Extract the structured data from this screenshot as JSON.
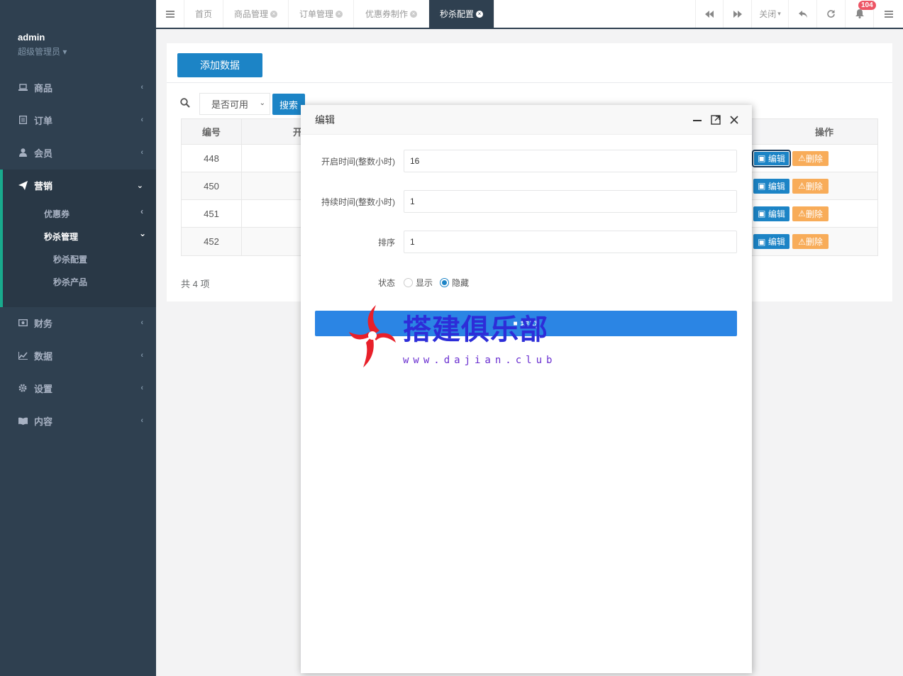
{
  "sidebar": {
    "user": "admin",
    "role": "超级管理员",
    "menu": [
      {
        "label": "商品",
        "icon": "laptop-icon"
      },
      {
        "label": "订单",
        "icon": "list-icon"
      },
      {
        "label": "会员",
        "icon": "user-icon"
      },
      {
        "label": "营销",
        "icon": "send-icon"
      },
      {
        "label": "财务",
        "icon": "money-icon"
      },
      {
        "label": "数据",
        "icon": "chart-icon"
      },
      {
        "label": "设置",
        "icon": "gear-icon"
      },
      {
        "label": "内容",
        "icon": "book-icon"
      }
    ],
    "submenu": {
      "coupon": "优惠券",
      "seckill": "秒杀管理",
      "seckill_config": "秒杀配置",
      "seckill_product": "秒杀产品"
    }
  },
  "topbar": {
    "tabs": [
      "首页",
      "商品管理",
      "订单管理",
      "优惠券制作",
      "秒杀配置"
    ],
    "active_tab": "秒杀配置",
    "close_label": "关闭",
    "notification_count": "104"
  },
  "toolbar": {
    "add_label": "添加数据",
    "filter_value": "是否可用",
    "search_label": "搜索"
  },
  "table": {
    "headers": {
      "id": "编号",
      "open": "开",
      "ops": "操作"
    },
    "rows": [
      {
        "id": "448"
      },
      {
        "id": "450"
      },
      {
        "id": "451"
      },
      {
        "id": "452"
      }
    ],
    "edit_label": "编辑",
    "delete_label": "删除",
    "total": "共 4 项"
  },
  "modal": {
    "title": "编辑",
    "fields": [
      {
        "label": "开启时间(整数小时)",
        "value": "16"
      },
      {
        "label": "持续时间(整数小时)",
        "value": "1"
      },
      {
        "label": "排序",
        "value": "1"
      }
    ],
    "status_label": "状态",
    "status_options": [
      "显示",
      "隐藏"
    ],
    "status_selected": "隐藏",
    "submit_label": "提交"
  },
  "watermark": {
    "title": "搭建俱乐部",
    "url": "www.dajian.club"
  },
  "colors": {
    "sidebar": "#2f4050",
    "primary": "#1c84c6",
    "warning": "#f8ac59",
    "submit": "#2b85e4",
    "badge": "#ed5565"
  }
}
